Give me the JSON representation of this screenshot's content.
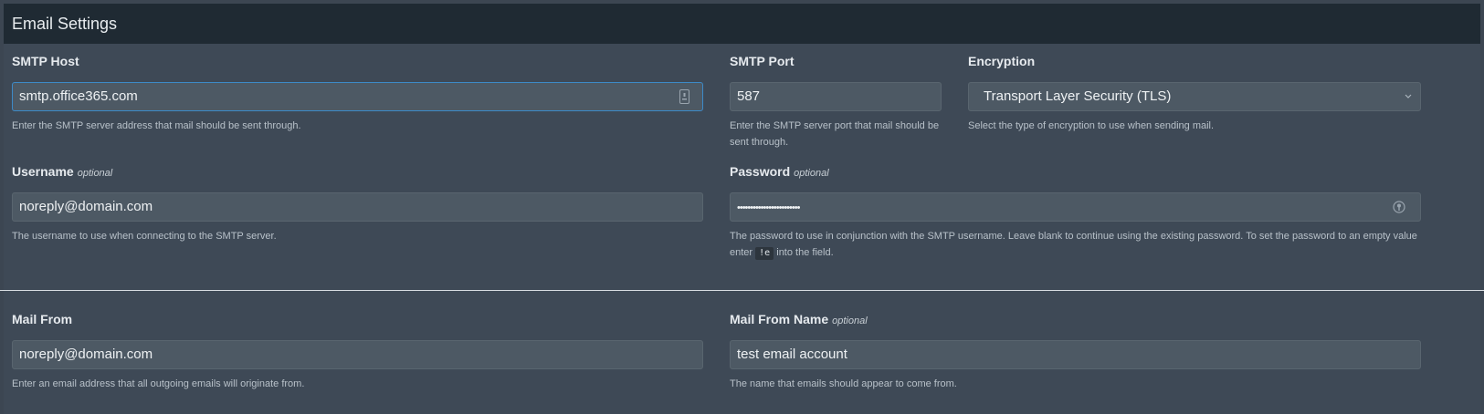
{
  "header": {
    "title": "Email Settings"
  },
  "smtp_host": {
    "label": "SMTP Host",
    "value": "smtp.office365.com",
    "help": "Enter the SMTP server address that mail should be sent through."
  },
  "smtp_port": {
    "label": "SMTP Port",
    "value": "587",
    "help": "Enter the SMTP server port that mail should be sent through."
  },
  "encryption": {
    "label": "Encryption",
    "value": "Transport Layer Security (TLS)",
    "help": "Select the type of encryption to use when sending mail."
  },
  "username": {
    "label": "Username",
    "optional": "optional",
    "value": "noreply@domain.com",
    "help": "The username to use when connecting to the SMTP server."
  },
  "password": {
    "label": "Password",
    "optional": "optional",
    "value": "••••••••••••••••••••••••",
    "help_before": "The password to use in conjunction with the SMTP username. Leave blank to continue using the existing password. To set the password to an empty value enter",
    "help_code": "!e",
    "help_after": "into the field."
  },
  "mail_from": {
    "label": "Mail From",
    "value": "noreply@domain.com",
    "help": "Enter an email address that all outgoing emails will originate from."
  },
  "mail_from_name": {
    "label": "Mail From Name",
    "optional": "optional",
    "value": "test email account",
    "help": "The name that emails should appear to come from."
  }
}
